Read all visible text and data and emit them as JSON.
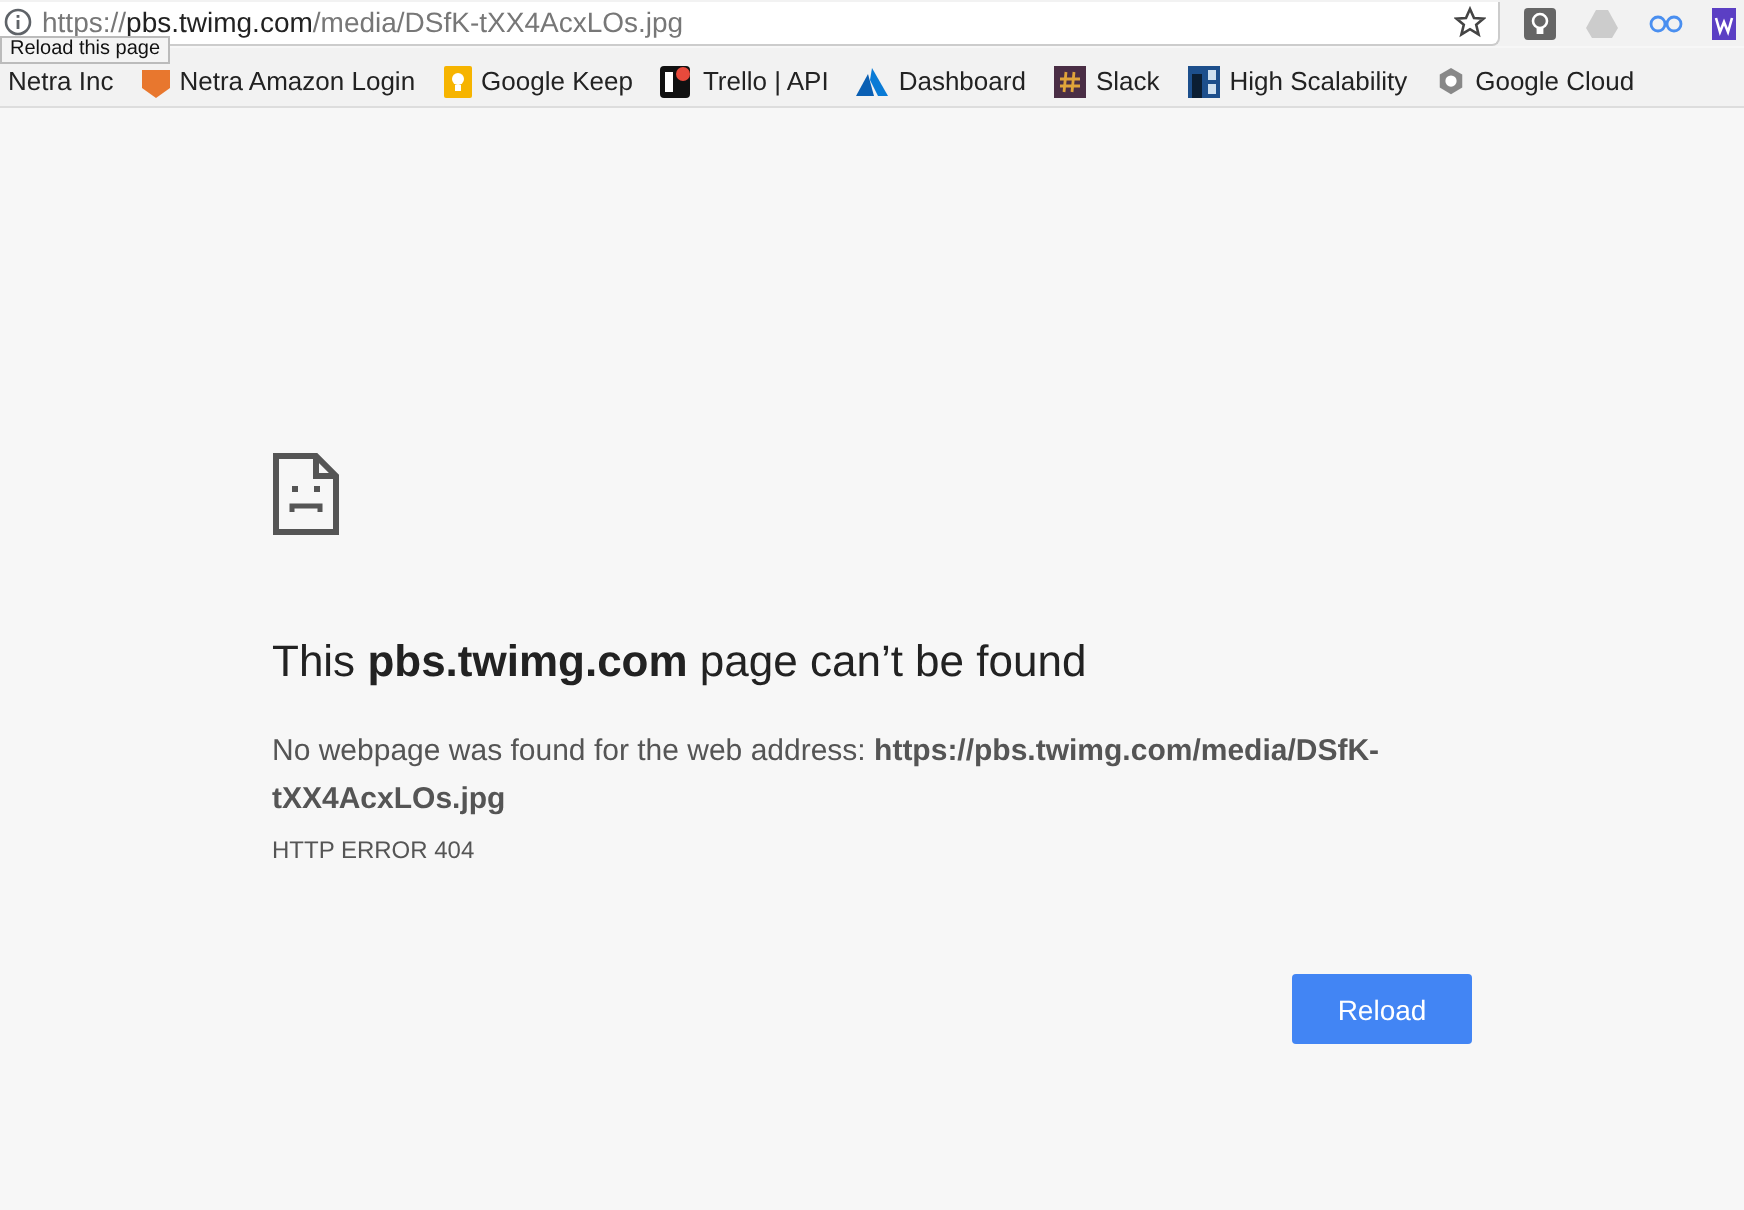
{
  "address_bar": {
    "scheme": "https://",
    "host": "pbs.twimg.com",
    "path": "/media/DSfK-tXX4AcxLOs.jpg"
  },
  "tooltip": "Reload this page",
  "bookmarks": [
    {
      "label": "Netra Inc",
      "kind": "none"
    },
    {
      "label": "Netra Amazon Login",
      "kind": "amazon"
    },
    {
      "label": "Google Keep",
      "kind": "keep"
    },
    {
      "label": "Trello | API",
      "kind": "trello"
    },
    {
      "label": "Dashboard",
      "kind": "azure"
    },
    {
      "label": "Slack",
      "kind": "slack"
    },
    {
      "label": "High Scalability",
      "kind": "hs"
    },
    {
      "label": "Google Cloud",
      "kind": "cloud"
    }
  ],
  "error": {
    "heading": "This **pbs.twimg.com** page can’t be found",
    "message": "No webpage was found for the web address: **https://pbs.twimg.com/media/DSfK-tXX4AcxLOs.jpg**",
    "code": "HTTP ERROR 404",
    "button": "Reload"
  }
}
